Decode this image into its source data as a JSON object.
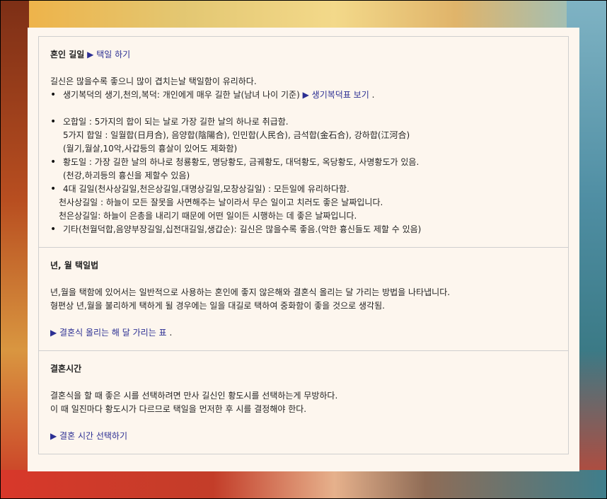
{
  "sections": [
    {
      "title": "혼인 길일",
      "link": "▶ 택일 하기",
      "intro": "길신은 많을수록 좋으니 많이 겹치는날 택일함이 유리하다.",
      "item1": "생기복덕의 생기,천의,복덕: 개인에게 매우 길한 날(남녀 나이 기준)",
      "item1_link": "▶ 생기복덕표 보기",
      "item1_suffix": ".",
      "item2": "오합일 : 5가지의 합이 되는 날로 가장 길한 날의 하나로 취급함.",
      "item2_l1": "5가지 합일 : 일월합(日月合), 음양합(陰陽合), 인민합(人民合), 금석합(金石合), 강하합(江河合)",
      "item2_l2": "(월기,월살,10악,사갑등의 흉살이 있어도 제화함)",
      "item3": "황도일 : 가장 길한 날의 하나로 청룡황도, 명당황도, 금궤황도, 대덕황도, 옥당황도, 사명황도가 있음.",
      "item3_l1": "(천강,하괴등의 흉신을 제할수 있음)",
      "item4": "4대 길일(천사상길일,천은상길일,대명상길일,모창상길일) : 모든일에 유리하다함.",
      "item4_l1": "천사상길일 : 하늘이 모든 잘못을 사면해주는 날이라서 무슨 일이고 치러도 좋은 날짜입니다.",
      "item4_l2": "천은상길일: 하늘이 은총을 내리기 때문에 어떤 일이든 시행하는 데 좋은 날짜입니다.",
      "item5": "기타(천월덕합,음양부장길일,십전대길일,생갑순): 길신은 많을수록 좋음.(악한 흉신들도 제할 수 있음)"
    },
    {
      "title": "년, 월 택일법",
      "line1": "년,월을 택함에 있어서는 일반적으로 사용하는 혼인에 좋지 않은해와 결혼식 올리는 달 가리는 방법을 나타냅니다.",
      "line2": "형편상 년,월을 불리하게 택하게 될 경우에는 일을 대길로 택하여 중화함이 좋을 것으로 생각됨.",
      "link": "▶ 결혼식 올리는 해 달 가리는 표",
      "link_suffix": "."
    },
    {
      "title": "결혼시간",
      "line1": "결혼식을 할 때 좋은 시를 선택하려면 만사 길신인 황도시를 선택하는게 무방하다.",
      "line2": "이 때 일진마다 황도시가 다르므로 택일을 먼저한 후 시를 결정해야 한다.",
      "link": "▶ 결혼 시간 선택하기"
    }
  ],
  "colors": {
    "link": "#2c2f93",
    "panel": "#fdf6ee",
    "border": "#cfcfcf"
  }
}
